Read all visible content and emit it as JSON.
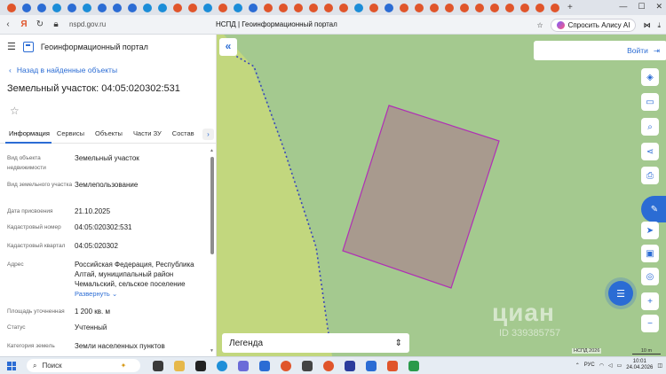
{
  "browser": {
    "url": "nspd.gov.ru",
    "page_title": "НСПД | Геоинформационный портал",
    "alice_label": "Спросить Алису AI",
    "tab_colors": [
      "#e0552b",
      "#2b6cd4",
      "#2b6cd4",
      "#1b8dd8",
      "#2b6cd4",
      "#1b8dd8",
      "#2b6cd4",
      "#2b6cd4",
      "#2b6cd4",
      "#1b8dd8",
      "#1b8dd8",
      "#e0552b",
      "#e0552b",
      "#1b8dd8",
      "#e0552b",
      "#1b8dd8",
      "#2b6cd4",
      "#e0552b",
      "#e0552b",
      "#e0552b",
      "#e0552b",
      "#e0552b",
      "#e0552b",
      "#1b8dd8",
      "#e0552b",
      "#2b6cd4",
      "#e0552b",
      "#e0552b",
      "#e0552b",
      "#e0552b",
      "#e0552b",
      "#e0552b",
      "#e0552b",
      "#e0552b",
      "#e0552b",
      "#e0552b",
      "#e0552b"
    ]
  },
  "panel": {
    "portal_name": "Геоинформационный портал",
    "back_link": "Назад в найденные объекты",
    "object_title": "Земельный участок: 04:05:020302:531",
    "tabs": [
      "Информация",
      "Сервисы",
      "Объекты",
      "Части ЗУ",
      "Состав"
    ],
    "fields": [
      {
        "key": "Вид объекта недвижимости",
        "value": "Земельный участок"
      },
      {
        "key": "Вид земельного участка",
        "value": "Землепользование"
      },
      {
        "key": "Дата присвоения",
        "value": "21.10.2025"
      },
      {
        "key": "Кадастровый номер",
        "value": "04:05:020302:531"
      },
      {
        "key": "Кадастровый квартал",
        "value": "04:05:020302"
      },
      {
        "key": "Адрес",
        "value": "Российская Федерация, Республика Алтай, муниципальный район Чемальский, сельское поселение"
      },
      {
        "key": "Площадь уточненная",
        "value": "1 200 кв. м"
      },
      {
        "key": "Статус",
        "value": "Учтенный"
      },
      {
        "key": "Категория земель",
        "value": "Земли населенных пунктов"
      }
    ],
    "expand_label": "Развернуть"
  },
  "map": {
    "login_label": "Войти",
    "legend_label": "Легенда",
    "watermark": "циан",
    "watermark_id": "ID 339385757",
    "attribution": "НСПД 2026",
    "scale": "10 m"
  },
  "taskbar": {
    "search_placeholder": "Поиск",
    "lang": "РУС",
    "time": "10:01",
    "date": "24.04.2026"
  },
  "colors": {
    "accent": "#2b6cd4",
    "map_green": "#a4c98f",
    "map_light_green": "#c2d77e",
    "parcel_fill": "#a89a8e",
    "parcel_stroke": "#b02fb5"
  }
}
